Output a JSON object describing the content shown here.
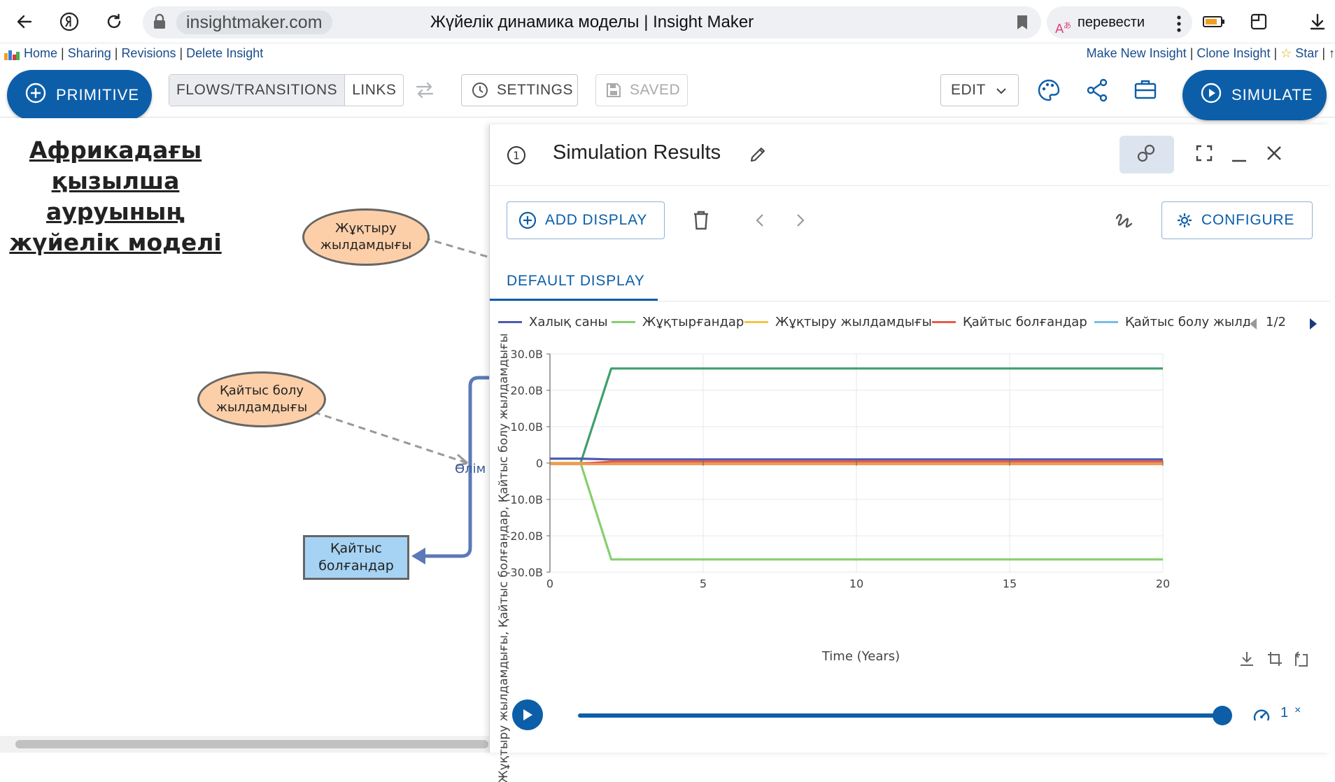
{
  "browser": {
    "domain": "insightmaker.com",
    "page_title": "Жүйелік динамика моделы | Insight Maker",
    "translate_label": "перевести"
  },
  "insight_links": {
    "left": [
      "Home",
      "Sharing",
      "Revisions",
      "Delete Insight"
    ],
    "right": [
      "Make New Insight",
      "Clone Insight",
      "Star"
    ]
  },
  "toolbar": {
    "primitive": "PRIMITIVE",
    "flows_transitions": "FLOWS/TRANSITIONS",
    "links": "LINKS",
    "settings": "SETTINGS",
    "saved": "SAVED",
    "edit": "EDIT",
    "simulate": "SIMULATE"
  },
  "canvas": {
    "title": "Африкадағы қызылша ауруының жүйелік моделі",
    "ellipse_infection": "Жұқтыру жылдамдығы",
    "ellipse_death": "Қайтыс болу жылдамдығы",
    "flow_label": "Өлім",
    "stock_dead": "Қайтыс болғандар"
  },
  "panel": {
    "number": "1",
    "title": "Simulation Results",
    "add_display": "ADD DISPLAY",
    "configure": "CONFIGURE",
    "tab": "DEFAULT DISPLAY",
    "legend_page": "1/2",
    "speed": "1",
    "speed_suffix": "×"
  },
  "chart_data": {
    "type": "line",
    "xlabel": "Time (Years)",
    "ylabel": "Жұқтыру жылдамдығы, Қайтыс болғандар, Қайтыс болу жылдамдығы",
    "xlim": [
      0,
      20
    ],
    "ylim": [
      -30,
      30
    ],
    "x_ticks": [
      "0",
      "5",
      "10",
      "15",
      "20"
    ],
    "y_ticks": [
      "30.0B",
      "20.0B",
      "10.0B",
      "0",
      "-10.0B",
      "-20.0B",
      "-30.0B"
    ],
    "grid": true,
    "legend_position": "top",
    "legend": [
      {
        "name": "Халық саны",
        "color": "#4a5cb0"
      },
      {
        "name": "Жұқтырғандар",
        "color": "#86cf6e"
      },
      {
        "name": "Жұқтыру жылдамдығы",
        "color": "#f4c542"
      },
      {
        "name": "Қайтыс болғандар",
        "color": "#e85c4a"
      },
      {
        "name": "Қайтыс болу жылдам",
        "color": "#79bde6"
      }
    ],
    "series": [
      {
        "color": "#3f9f6b",
        "x": [
          0,
          1,
          2,
          20
        ],
        "y": [
          0,
          0,
          26,
          26
        ]
      },
      {
        "color": "#86cf6e",
        "x": [
          0,
          1,
          2,
          20
        ],
        "y": [
          0,
          0,
          -26.5,
          -26.5
        ]
      },
      {
        "name": "Халық саны",
        "color": "#4a5cb0",
        "x": [
          0,
          1,
          2,
          20
        ],
        "y": [
          1.2,
          1.2,
          1.0,
          1.0
        ]
      },
      {
        "name": "Жұқтыру жылдамдығы",
        "color": "#f4c542",
        "x": [
          0,
          20
        ],
        "y": [
          0,
          0
        ]
      },
      {
        "name": "Қайтыс болғандар",
        "color": "#e85c4a",
        "x": [
          0,
          1,
          2,
          20
        ],
        "y": [
          -0.2,
          -0.2,
          0.4,
          0.4
        ]
      },
      {
        "color": "#f09a5a",
        "x": [
          0,
          20
        ],
        "y": [
          -0.3,
          -0.3
        ]
      }
    ]
  }
}
